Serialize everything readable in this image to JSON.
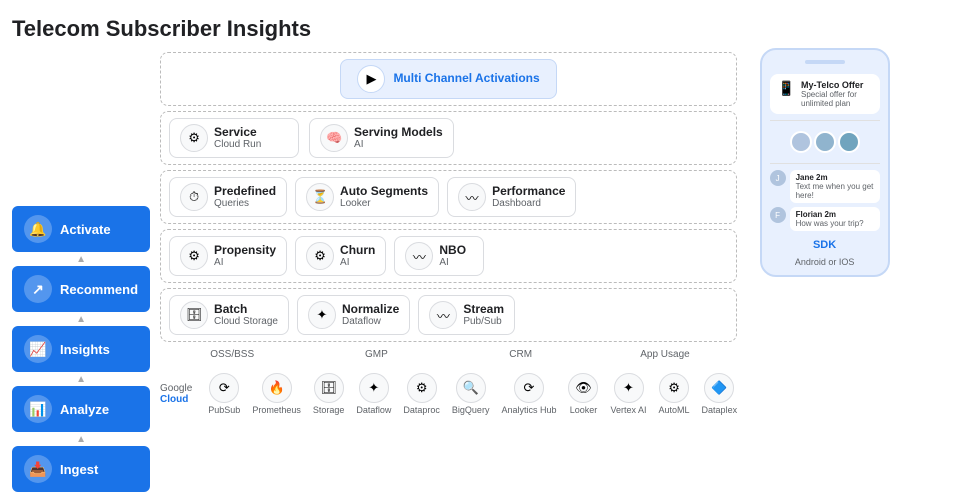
{
  "title": "Telecom Subscriber Insights",
  "sidebar": {
    "items": [
      {
        "label": "Activate",
        "icon": "🔔"
      },
      {
        "label": "Recommend",
        "icon": "↗"
      },
      {
        "label": "Insights",
        "icon": "📈"
      },
      {
        "label": "Analyze",
        "icon": "📊"
      },
      {
        "label": "Ingest",
        "icon": "📥"
      }
    ]
  },
  "diagram": {
    "row1": {
      "label": "Multi Channel Activations",
      "icon": "▶"
    },
    "row2": {
      "items": [
        {
          "title": "Service",
          "sub": "Cloud Run",
          "icon": "⚙"
        },
        {
          "title": "Serving Models",
          "sub": "AI",
          "icon": "🧠"
        }
      ]
    },
    "row3": {
      "items": [
        {
          "title": "Predefined",
          "sub": "Queries",
          "icon": "⏱"
        },
        {
          "title": "Auto Segments",
          "sub": "Looker",
          "icon": "⏳"
        },
        {
          "title": "Performance",
          "sub": "Dashboard",
          "icon": "〰"
        }
      ]
    },
    "row4": {
      "items": [
        {
          "title": "Propensity",
          "sub": "AI",
          "icon": "⚙"
        },
        {
          "title": "Churn",
          "sub": "AI",
          "icon": "⚙"
        },
        {
          "title": "NBO",
          "sub": "AI",
          "icon": "〰"
        }
      ]
    },
    "row5": {
      "items": [
        {
          "title": "Batch",
          "sub": "Cloud Storage",
          "icon": "🗄"
        },
        {
          "title": "Normalize",
          "sub": "Dataflow",
          "icon": "✦"
        },
        {
          "title": "Stream",
          "sub": "Pub/Sub",
          "icon": "〰"
        }
      ]
    },
    "source_labels": [
      "OSS/BSS",
      "GMP",
      "CRM",
      "App Usage"
    ]
  },
  "phone": {
    "offer_title": "My-Telco Offer",
    "offer_sub": "Special offer for unlimited plan",
    "chats": [
      {
        "name": "Jane 2m",
        "msg": "Text me when you get here!"
      },
      {
        "name": "Florian 2m",
        "msg": "How was your trip?"
      }
    ],
    "sdk_label": "SDK",
    "os_label": "Android or IOS"
  },
  "bottom_icons": [
    {
      "label": "PubSub",
      "icon": "⟳"
    },
    {
      "label": "Prometheus",
      "icon": "🔥"
    },
    {
      "label": "Storage",
      "icon": "🗄"
    },
    {
      "label": "Dataflow",
      "icon": "✦"
    },
    {
      "label": "Dataproc",
      "icon": "⚙"
    },
    {
      "label": "BigQuery",
      "icon": "🔍"
    },
    {
      "label": "Analytics Hub",
      "icon": "⟳"
    },
    {
      "label": "Looker",
      "icon": "👁"
    },
    {
      "label": "Vertex AI",
      "icon": "✦"
    },
    {
      "label": "AutoML",
      "icon": "⚙"
    },
    {
      "label": "Dataplex",
      "icon": "🔷"
    }
  ]
}
